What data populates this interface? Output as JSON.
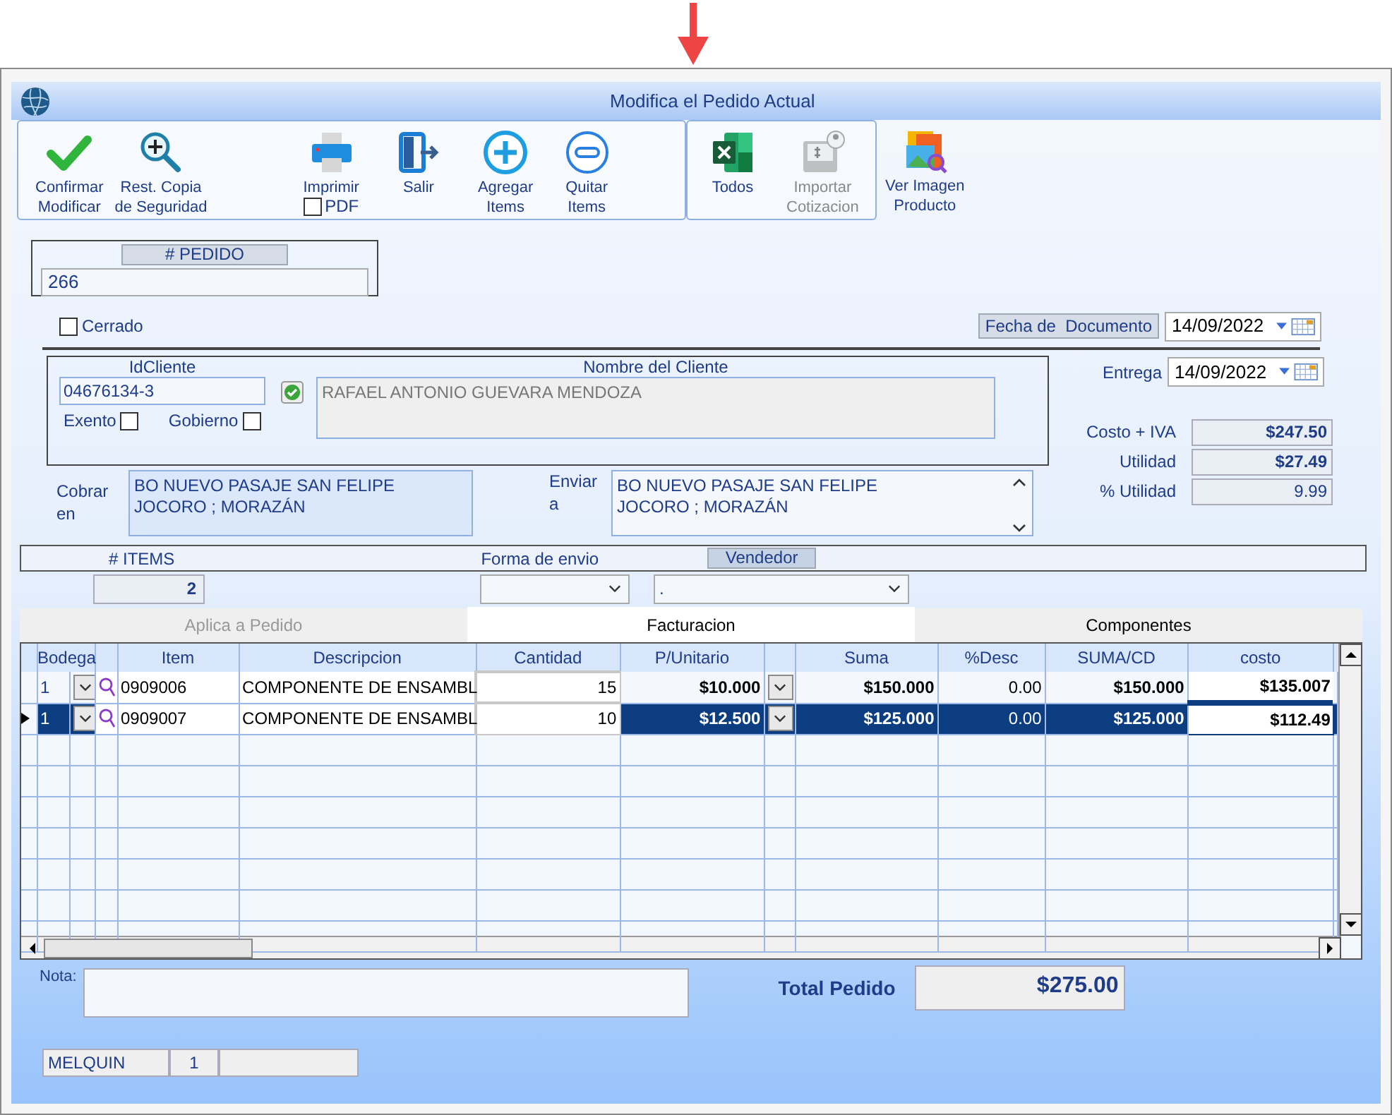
{
  "window": {
    "title": "Modifica el Pedido Actual"
  },
  "toolbar": {
    "groups": [
      {
        "framed": true,
        "buttons": [
          {
            "lines": [
              "Confirmar",
              "Modificar"
            ],
            "disabled": false
          },
          {
            "lines": [
              "Rest. Copia",
              "de Seguridad"
            ],
            "disabled": false
          },
          {
            "lines": [
              "Imprimir"
            ],
            "disabled": false,
            "checkbox": {
              "label": "PDF",
              "checked": false
            }
          },
          {
            "lines": [
              "Salir"
            ],
            "disabled": false
          },
          {
            "lines": [
              "Agregar",
              "Items"
            ],
            "disabled": false
          },
          {
            "lines": [
              "Quitar",
              "Items"
            ],
            "disabled": false
          }
        ]
      },
      {
        "framed": true,
        "buttons": [
          {
            "lines": [
              "Todos"
            ],
            "disabled": false
          },
          {
            "lines": [
              "Importar",
              "Cotizacion"
            ],
            "disabled": true
          }
        ]
      },
      {
        "framed": false,
        "buttons": [
          {
            "lines": [
              "Ver Imagen",
              "Producto"
            ],
            "disabled": false
          }
        ]
      }
    ]
  },
  "pedido": {
    "label": "# PEDIDO",
    "value": "266"
  },
  "cerrado": {
    "label": "Cerrado",
    "checked": false
  },
  "fecha_documento": {
    "label": "Fecha de  Documento",
    "value": "14/09/2022"
  },
  "cliente": {
    "id_label": "IdCliente",
    "id_value": "04676134-3",
    "name_label": "Nombre del Cliente",
    "name_value": "RAFAEL ANTONIO GUEVARA MENDOZA",
    "flags": [
      {
        "label": "Exento",
        "checked": false
      },
      {
        "label": "Gobierno",
        "checked": false
      }
    ]
  },
  "entrega": {
    "label": "Entrega",
    "value": "14/09/2022"
  },
  "totals": [
    {
      "label": "Costo + IVA",
      "value": "$247.50",
      "bold": true
    },
    {
      "label": "Utilidad",
      "value": "$27.49",
      "bold": true
    },
    {
      "label": "% Utilidad",
      "value": "9.99",
      "bold": false
    }
  ],
  "cobrar": {
    "label": "Cobrar en",
    "value": "BO NUEVO PASAJE SAN FELIPE\nJOCORO ; MORAZÁN"
  },
  "enviar": {
    "label": "Enviar a",
    "value": "BO NUEVO PASAJE SAN FELIPE\nJOCORO ; MORAZÁN"
  },
  "items": {
    "label": "# ITEMS",
    "value": "2"
  },
  "forma_envio": {
    "label": "Forma de envio"
  },
  "vendedor": {
    "label": "Vendedor",
    "value": "."
  },
  "tabs": [
    {
      "label": "Aplica a Pedido",
      "selected": false,
      "disabled": true
    },
    {
      "label": "Facturacion",
      "selected": true,
      "disabled": false
    },
    {
      "label": "Componentes",
      "selected": false,
      "disabled": false
    }
  ],
  "grid": {
    "columns": [
      "Bodega",
      "Item",
      "Descripcion",
      "Cantidad",
      "P/Unitario",
      "Suma",
      "%Desc",
      "SUMA/CD",
      "costo"
    ],
    "rows": [
      {
        "selected": false,
        "cells": [
          "1",
          "0909006",
          "COMPONENTE DE ENSAMBL",
          "15",
          "$10.000",
          "$150.000",
          "0.00",
          "$150.000",
          "$135.007"
        ]
      },
      {
        "selected": true,
        "cells": [
          "1",
          "0909007",
          "COMPONENTE DE ENSAMBL",
          "10",
          "$12.500",
          "$125.000",
          "0.00",
          "$125.000",
          "$112.49"
        ]
      }
    ]
  },
  "nota": {
    "label": "Nota:"
  },
  "total": {
    "label": "Total Pedido",
    "value": "$275.00"
  },
  "status_bar": [
    "MELQUIN",
    "1"
  ]
}
